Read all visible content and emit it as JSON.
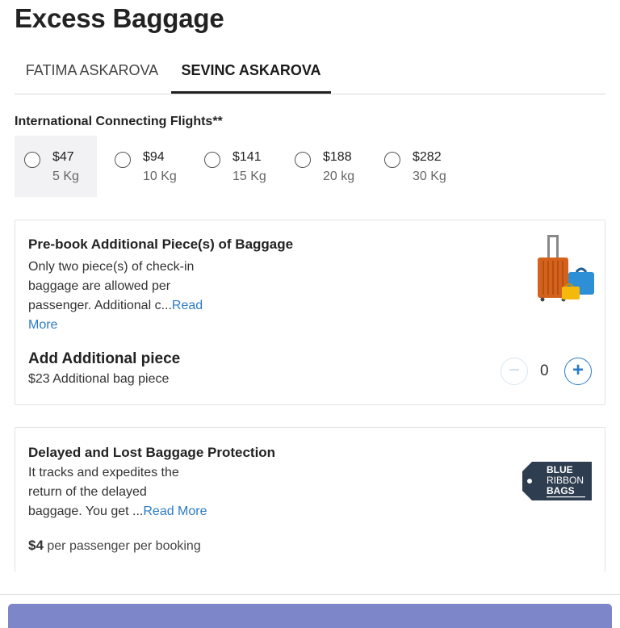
{
  "page_title": "Excess Baggage",
  "tabs": [
    {
      "label": "FATIMA ASKAROVA",
      "active": false
    },
    {
      "label": "SEVINC ASKAROVA",
      "active": true
    }
  ],
  "weights_section": {
    "title": "International Connecting Flights**",
    "selected_index": 0,
    "options": [
      {
        "price": "$47",
        "weight": "5 Kg"
      },
      {
        "price": "$94",
        "weight": "10 Kg"
      },
      {
        "price": "$141",
        "weight": "15 Kg"
      },
      {
        "price": "$188",
        "weight": "20 kg"
      },
      {
        "price": "$282",
        "weight": "30 Kg"
      }
    ]
  },
  "additional_piece_card": {
    "title": "Pre-book Additional Piece(s) of Baggage",
    "desc_line1": "Only two piece(s) of check-in",
    "desc_line2": "baggage are allowed per",
    "desc_line3": "passenger. Additional c...",
    "read_more_1": "Read",
    "read_more_2": "More",
    "image_icon": "luggage-icon",
    "add_title": "Add Additional piece",
    "add_sub": "$23 Additional bag piece",
    "stepper": {
      "minus": "−",
      "value": "0",
      "plus": "+"
    }
  },
  "protection_card": {
    "title": "Delayed and Lost Baggage Protection",
    "desc_line1": "It tracks and expedites the",
    "desc_line2": "return of the delayed",
    "desc_line3": "baggage. You get ...",
    "read_more": "Read More",
    "logo": {
      "line1": "BLUE",
      "line2": "RIBBON",
      "line3": "BAGS"
    },
    "price": "$4",
    "price_suffix": " per passenger per booking"
  },
  "colors": {
    "accent": "#2b7bc6",
    "continue_bar": "#7d86c9",
    "selected_bg": "#f2f2f4"
  }
}
